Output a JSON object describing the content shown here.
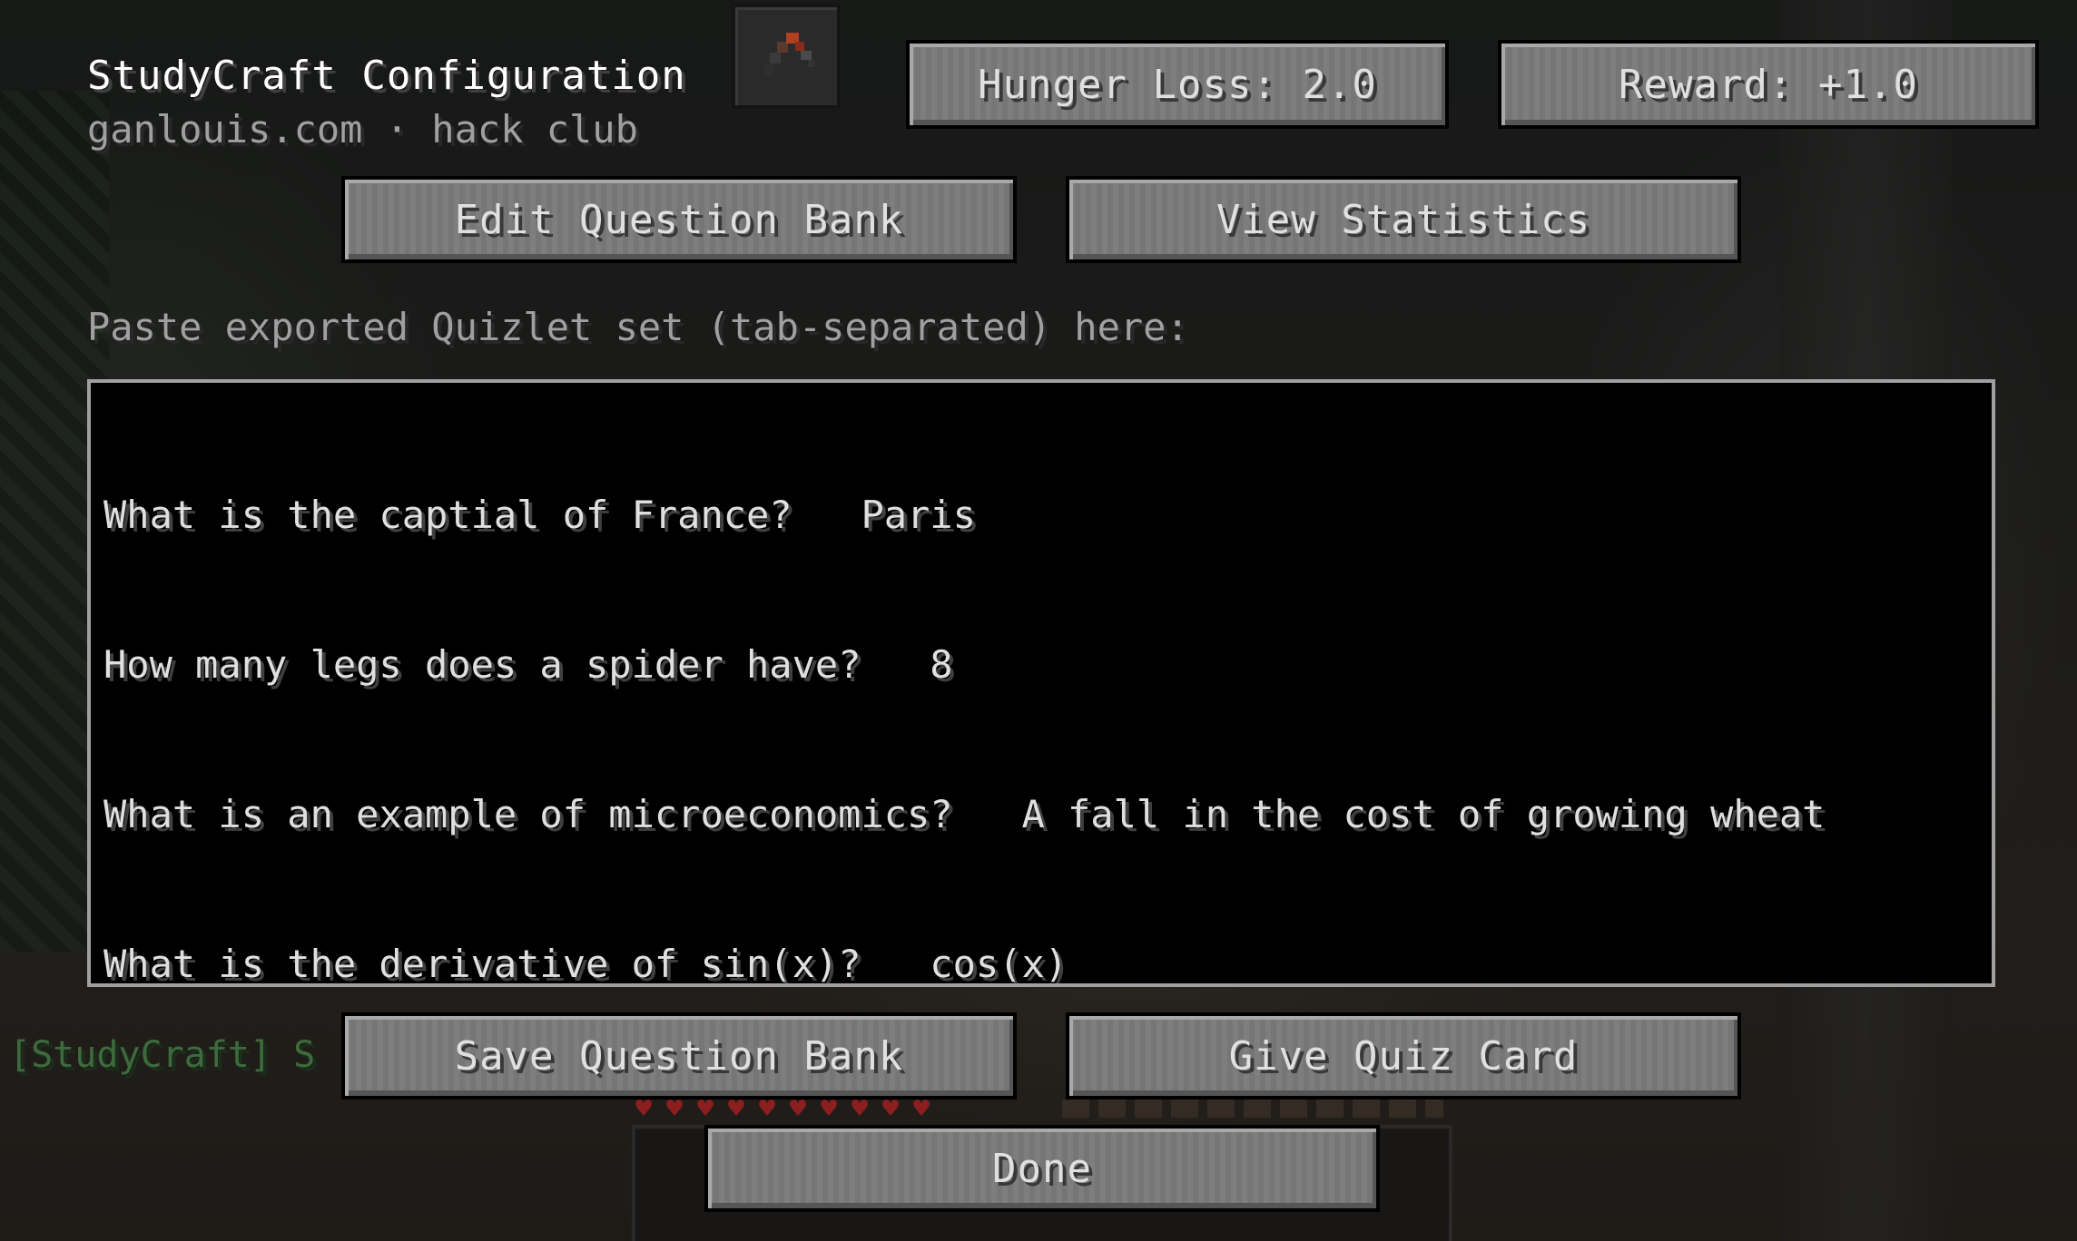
{
  "header": {
    "title": "StudyCraft Configuration",
    "subtitle": "ganlouis.com · hack club",
    "item_icon": "trident-item-icon"
  },
  "settings": {
    "hunger_loss_label": "Hunger Loss: 2.0",
    "reward_label": "Reward: +1.0"
  },
  "actions": {
    "edit_bank_label": "Edit Question Bank",
    "view_stats_label": "View Statistics",
    "save_bank_label": "Save Question Bank",
    "give_card_label": "Give Quiz Card",
    "done_label": "Done"
  },
  "import": {
    "prompt": "Paste exported Quizlet set (tab-separated) here:",
    "lines": [
      "What is the captial of France?   Paris",
      "How many legs does a spider have?   8",
      "What is an example of microeconomics?   A fall in the cost of growing wheat",
      "What is the derivative of sin(x)?   cos(x)"
    ]
  },
  "chat": {
    "prefix": "[StudyCraft] S"
  },
  "colors": {
    "button_face": "#7a7a7a",
    "button_text": "#e0e0e0",
    "text_area_bg": "#000000",
    "text_area_border": "#a0a0a0",
    "chat_prefix": "#3d6b3d"
  }
}
